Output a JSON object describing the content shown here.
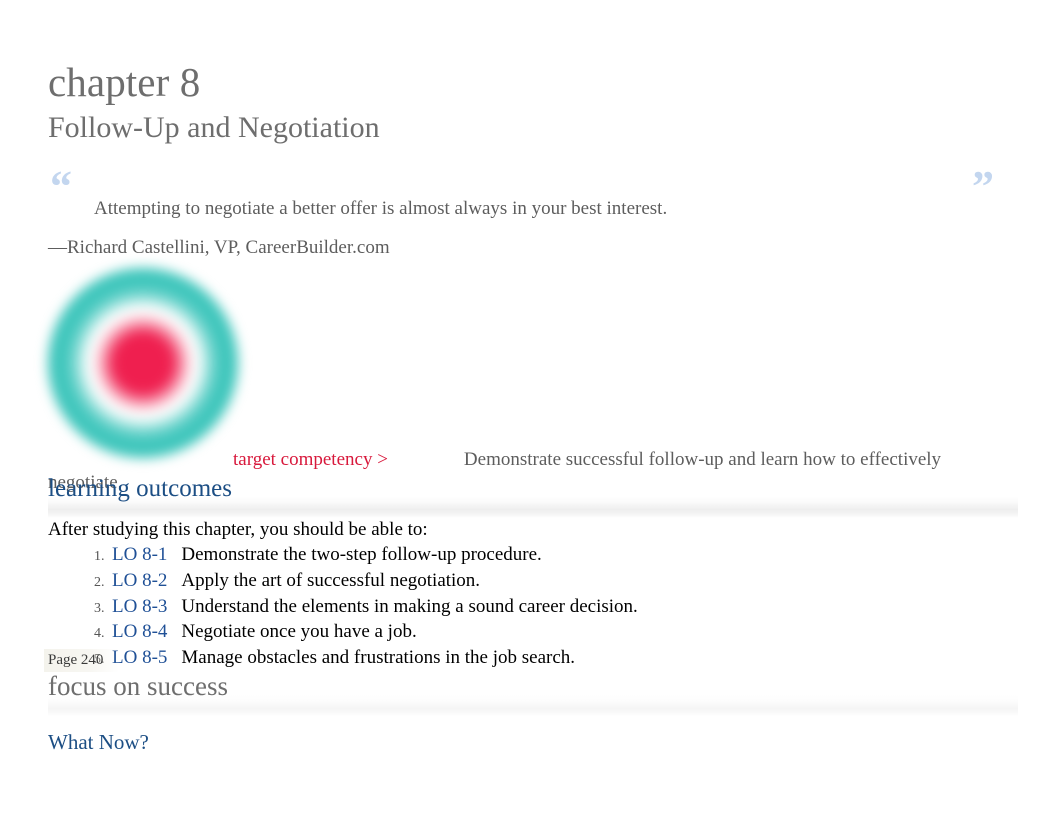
{
  "chapter": {
    "title": "chapter 8",
    "subtitle": "Follow-Up and Negotiation"
  },
  "pull_quote": {
    "open_mark": "“",
    "close_mark": "”",
    "text": "Attempting to negotiate a better offer is almost always in your best interest.",
    "attribution": "—Richard Castellini, VP, CareerBuilder.com"
  },
  "target_graphic": {
    "icon": "target-bullseye-icon",
    "center_color": "#ef1f4f",
    "ring_color": "#3fc6bc"
  },
  "competency": {
    "label": "target competency >",
    "label_color": "#d8193c",
    "text": "Demonstrate successful follow-up and learn how to effectively negotiate."
  },
  "learning_outcomes": {
    "heading": "learning outcomes",
    "heading_color": "#1c4e84",
    "intro": "After studying this chapter, you should be able to:",
    "items": [
      {
        "code": "LO 8-1",
        "text": "Demonstrate the two-step follow-up procedure."
      },
      {
        "code": "LO 8-2",
        "text": "Apply the art of successful negotiation."
      },
      {
        "code": "LO 8-3",
        "text": "Understand the elements in making a sound career decision."
      },
      {
        "code": "LO 8-4",
        "text": "Negotiate once you have a job."
      },
      {
        "code": "LO 8-5",
        "text": "Manage obstacles and frustrations in the job search."
      }
    ]
  },
  "page_marker": {
    "label": "Page 240"
  },
  "focus_on_success": {
    "heading": "focus on success",
    "subheading": "What Now?",
    "subheading_color": "#1c4e84"
  }
}
